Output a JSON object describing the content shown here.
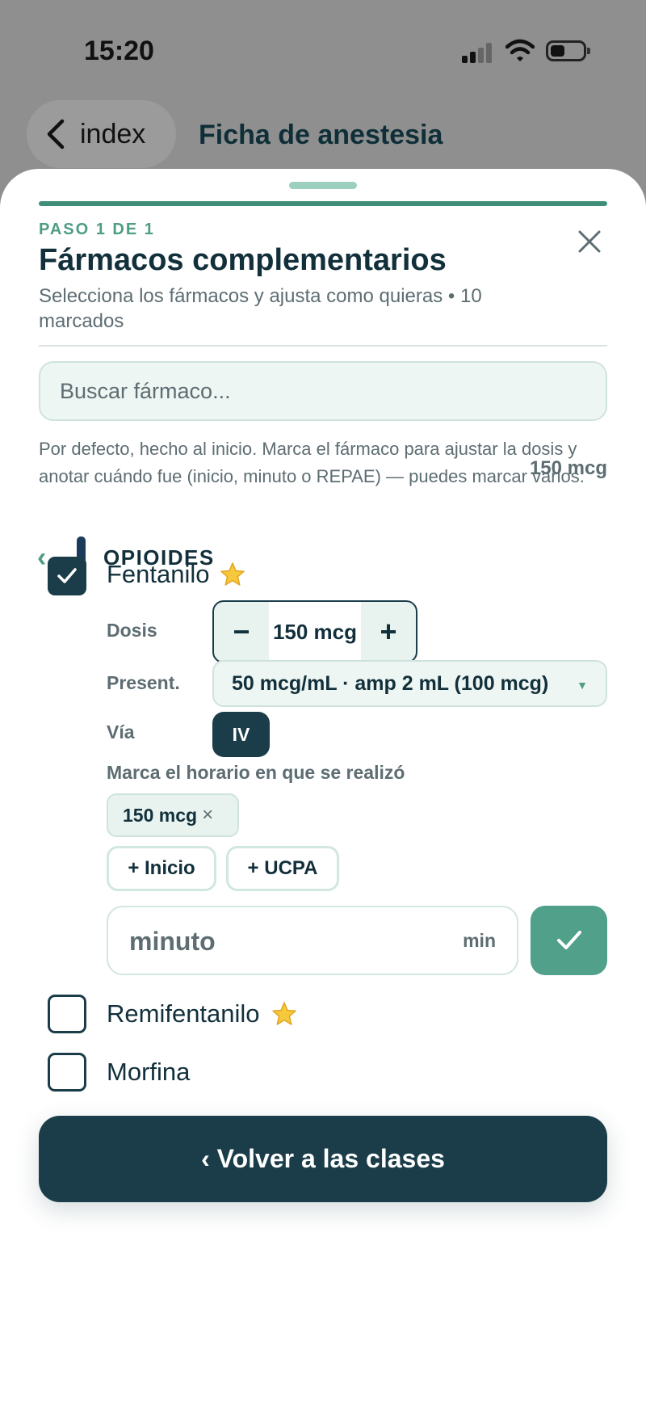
{
  "status_bar": {
    "time": "15:20"
  },
  "nav": {
    "back_label": "index",
    "title": "Ficha de anestesia"
  },
  "sheet": {
    "step_label": "PASO 1 DE 1",
    "title": "Fármacos complementarios",
    "subtitle": "Selecciona los fármacos y ajusta como quieras • 10 marcados",
    "search_placeholder": "Buscar fármaco...",
    "help_text": "Por defecto, hecho al inicio. Marca el fármaco para ajustar la dosis y anotar cuándo fue (inicio, minuto o REPAE) — puedes marcar varios.",
    "class_title": "OPIOIDES",
    "class_back": "‹"
  },
  "drugs": [
    {
      "name": "Fentanilo",
      "checked": true,
      "favorite": true,
      "dose_summary": "150 mcg",
      "dose_label": "Dosis",
      "dose_value": "150 mcg",
      "presentation_label": "Present.",
      "presentation_value": "50 mcg/mL · amp 2 mL (100 mcg)",
      "route_label": "Vía",
      "route_value": "IV",
      "time_heading": "Marca el horario en que se realizó",
      "recorded_chip": "150 mcg",
      "add_start_label": "+ Inicio",
      "add_ucpa_label": "+ UCPA",
      "minute_placeholder": "minuto",
      "minute_unit": "min"
    },
    {
      "name": "Remifentanilo",
      "checked": false,
      "favorite": true
    },
    {
      "name": "Morfina",
      "checked": false,
      "favorite": false
    }
  ],
  "footer": {
    "button_label": "‹ Volver a las clases"
  },
  "colors": {
    "primary": "#1b3d49",
    "accent": "#50a08a",
    "light_accent": "#eef6f3"
  }
}
